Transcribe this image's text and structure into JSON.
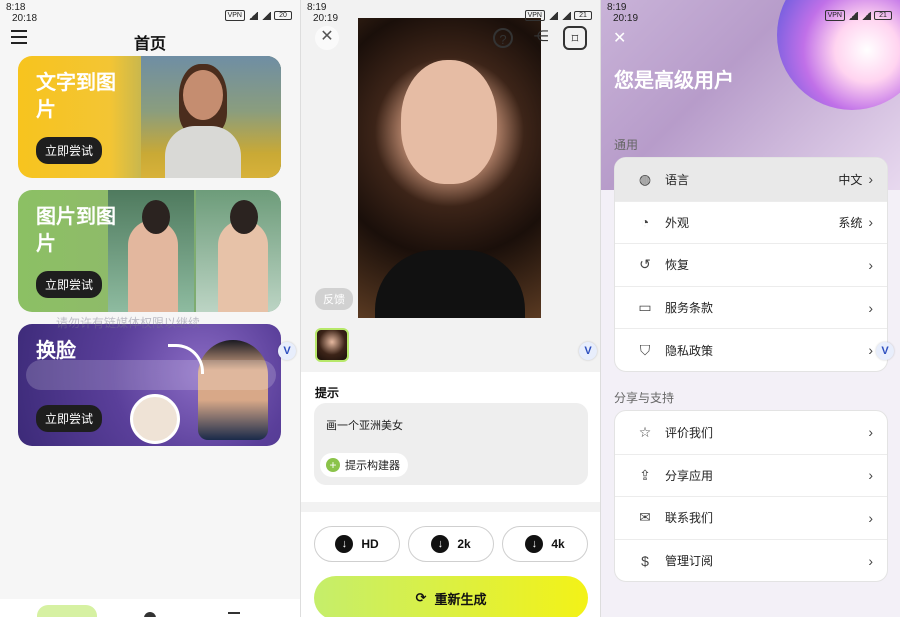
{
  "panel1": {
    "status": {
      "time_top": "8:18",
      "time_main": "20:18",
      "vpn": "VPN",
      "battery": "20"
    },
    "title": "首页",
    "cards": [
      {
        "label": "文字到图片",
        "button": "立即尝试"
      },
      {
        "label": "图片到图片",
        "button": "立即尝试"
      },
      {
        "label": "换脸",
        "button": "立即尝试"
      }
    ],
    "watermark": "请勿许有链媒体权限以继续",
    "badge": "V"
  },
  "panel2": {
    "status": {
      "time_top": "8:19",
      "time_main": "20:19",
      "vpn": "VPN",
      "battery": "21"
    },
    "top_icons": {
      "close": "close-icon",
      "help": "question-icon",
      "share": "share-icon",
      "bookmark": "bookmark-icon"
    },
    "feedback": "反馈",
    "prompt_title": "提示",
    "prompt_text": "画一个亚洲美女",
    "builder": "提示构建器",
    "resolutions": [
      "HD",
      "2k",
      "4k"
    ],
    "regenerate": "重新生成",
    "badge": "V"
  },
  "panel3": {
    "status": {
      "time_top": "8:19",
      "time_main": "20:19",
      "vpn": "VPN",
      "battery": "21"
    },
    "heading": "您是高级用户",
    "general_label": "通用",
    "general_items": [
      {
        "icon": "globe-icon",
        "glyph": "◍",
        "label": "语言",
        "value": "中文"
      },
      {
        "icon": "palette-icon",
        "glyph": "◔",
        "label": "外观",
        "value": "系统"
      },
      {
        "icon": "restore-icon",
        "glyph": "↺",
        "label": "恢复",
        "value": ""
      },
      {
        "icon": "document-icon",
        "glyph": "▭",
        "label": "服务条款",
        "value": ""
      },
      {
        "icon": "shield-icon",
        "glyph": "⛉",
        "label": "隐私政策",
        "value": ""
      }
    ],
    "share_label": "分享与支持",
    "share_items": [
      {
        "icon": "star-icon",
        "glyph": "☆",
        "label": "评价我们"
      },
      {
        "icon": "share-icon",
        "glyph": "⇪",
        "label": "分享应用"
      },
      {
        "icon": "mail-icon",
        "glyph": "✉",
        "label": "联系我们"
      },
      {
        "icon": "dollar-icon",
        "glyph": "$",
        "label": "管理订阅"
      }
    ],
    "badge": "V"
  }
}
